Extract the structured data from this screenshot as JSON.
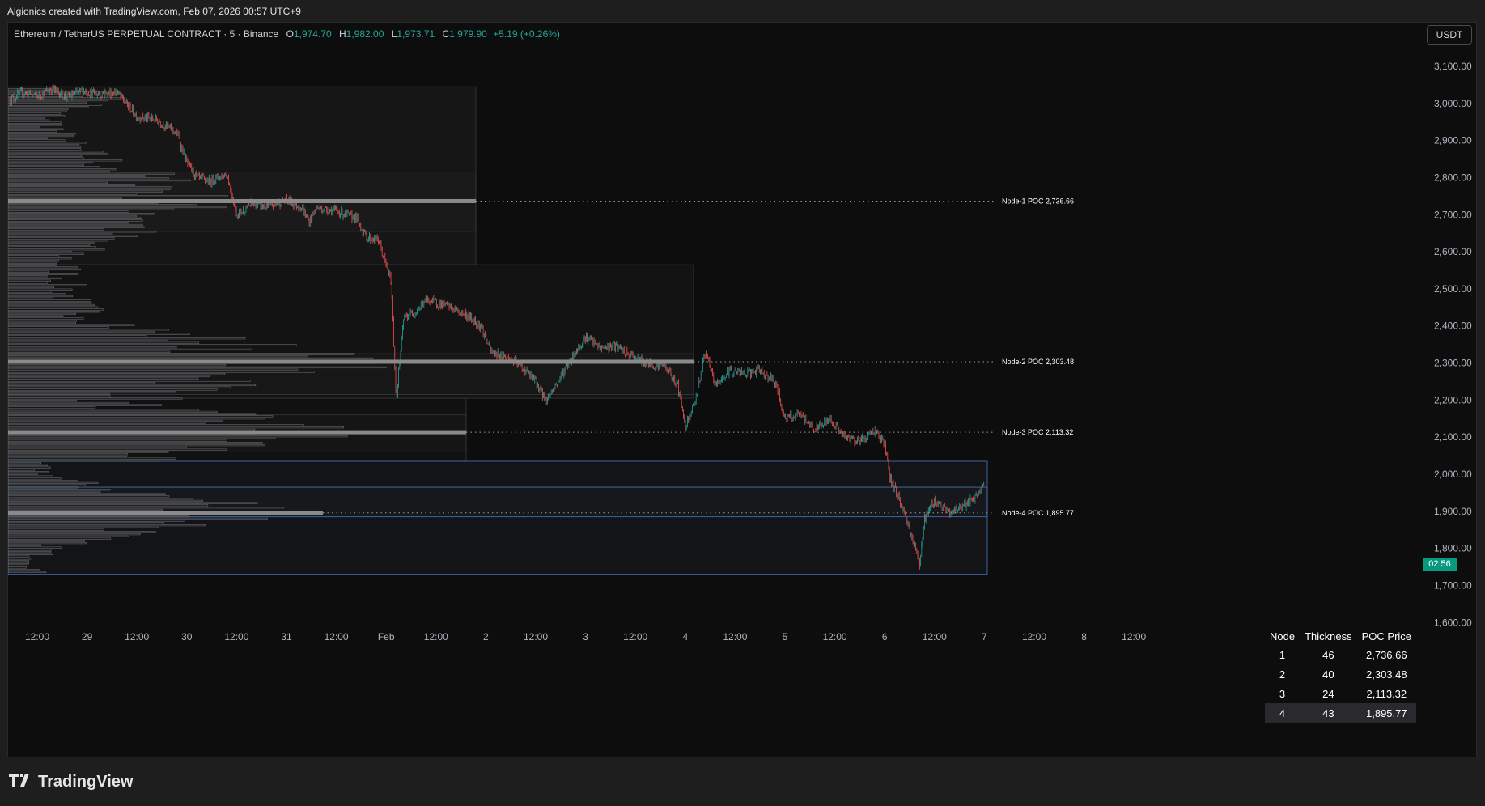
{
  "header": {
    "attribution": "Algionics created with TradingView.com, Feb 07, 2026 00:57 UTC+9"
  },
  "legend": {
    "symbol": "Ethereum / TetherUS PERPETUAL CONTRACT · 5 · Binance",
    "open_label": "O",
    "open": "1,974.70",
    "high_label": "H",
    "high": "1,982.00",
    "low_label": "L",
    "low": "1,973.71",
    "close_label": "C",
    "close": "1,979.90",
    "change": "+5.19 (+0.26%)"
  },
  "currency_button": "USDT",
  "countdown": "02:56",
  "table": {
    "headers": [
      "Node",
      "Thickness",
      "POC Price"
    ],
    "rows": [
      {
        "node": "1",
        "thickness": "46",
        "poc": "2,736.66"
      },
      {
        "node": "2",
        "thickness": "40",
        "poc": "2,303.48"
      },
      {
        "node": "3",
        "thickness": "24",
        "poc": "2,113.32"
      },
      {
        "node": "4",
        "thickness": "43",
        "poc": "1,895.77"
      }
    ]
  },
  "footer": {
    "brand": "TradingView"
  },
  "chart_data": {
    "type": "candlestick",
    "symbol": "ETHUSDT.P",
    "timeframe": "5",
    "x_ticks": [
      "12:00",
      "29",
      "12:00",
      "30",
      "12:00",
      "31",
      "12:00",
      "Feb",
      "12:00",
      "2",
      "12:00",
      "3",
      "12:00",
      "4",
      "12:00",
      "5",
      "12:00",
      "6",
      "12:00",
      "7",
      "12:00",
      "8",
      "12:00"
    ],
    "x_tick_units": [
      0,
      1,
      2,
      3,
      4,
      5,
      6,
      7,
      8,
      9,
      10,
      11,
      12,
      13,
      14,
      15,
      16,
      17,
      18,
      19,
      20,
      21,
      22
    ],
    "y_ticks": [
      "3,100.00",
      "3,000.00",
      "2,900.00",
      "2,800.00",
      "2,700.00",
      "2,600.00",
      "2,500.00",
      "2,400.00",
      "2,300.00",
      "2,200.00",
      "2,100.00",
      "2,000.00",
      "1,900.00",
      "1,800.00",
      "1,700.00",
      "1,600.00"
    ],
    "y_tick_values": [
      3100,
      3000,
      2900,
      2800,
      2700,
      2600,
      2500,
      2400,
      2300,
      2200,
      2100,
      2000,
      1900,
      1800,
      1700,
      1600
    ],
    "price_path": [
      [
        -0.55,
        3010
      ],
      [
        -0.3,
        3030
      ],
      [
        0.0,
        3020
      ],
      [
        0.3,
        3040
      ],
      [
        0.6,
        3015
      ],
      [
        0.9,
        3035
      ],
      [
        1.2,
        3025
      ],
      [
        1.6,
        3030
      ],
      [
        2.0,
        2965
      ],
      [
        2.4,
        2955
      ],
      [
        2.8,
        2920
      ],
      [
        3.0,
        2840
      ],
      [
        3.2,
        2800
      ],
      [
        3.45,
        2790
      ],
      [
        3.8,
        2810
      ],
      [
        4.0,
        2700
      ],
      [
        4.3,
        2730
      ],
      [
        4.6,
        2720
      ],
      [
        5.0,
        2740
      ],
      [
        5.3,
        2720
      ],
      [
        5.45,
        2680
      ],
      [
        5.6,
        2720
      ],
      [
        6.0,
        2710
      ],
      [
        6.4,
        2690
      ],
      [
        6.6,
        2640
      ],
      [
        6.85,
        2630
      ],
      [
        7.0,
        2560
      ],
      [
        7.1,
        2520
      ],
      [
        7.2,
        2200
      ],
      [
        7.35,
        2420
      ],
      [
        7.6,
        2440
      ],
      [
        7.8,
        2470
      ],
      [
        8.2,
        2455
      ],
      [
        8.6,
        2430
      ],
      [
        8.9,
        2400
      ],
      [
        9.1,
        2330
      ],
      [
        9.5,
        2310
      ],
      [
        9.8,
        2280
      ],
      [
        10.0,
        2250
      ],
      [
        10.2,
        2200
      ],
      [
        10.4,
        2240
      ],
      [
        10.7,
        2310
      ],
      [
        11.0,
        2370
      ],
      [
        11.3,
        2340
      ],
      [
        11.6,
        2345
      ],
      [
        11.9,
        2320
      ],
      [
        12.2,
        2300
      ],
      [
        12.6,
        2290
      ],
      [
        12.85,
        2240
      ],
      [
        13.0,
        2130
      ],
      [
        13.2,
        2200
      ],
      [
        13.4,
        2330
      ],
      [
        13.6,
        2240
      ],
      [
        13.9,
        2280
      ],
      [
        14.2,
        2270
      ],
      [
        14.5,
        2280
      ],
      [
        14.8,
        2250
      ],
      [
        15.0,
        2150
      ],
      [
        15.3,
        2160
      ],
      [
        15.6,
        2120
      ],
      [
        15.9,
        2150
      ],
      [
        16.2,
        2100
      ],
      [
        16.5,
        2090
      ],
      [
        16.8,
        2120
      ],
      [
        17.0,
        2080
      ],
      [
        17.1,
        1990
      ],
      [
        17.3,
        1930
      ],
      [
        17.5,
        1850
      ],
      [
        17.7,
        1760
      ],
      [
        17.8,
        1880
      ],
      [
        18.0,
        1930
      ],
      [
        18.3,
        1895
      ],
      [
        18.6,
        1920
      ],
      [
        18.8,
        1930
      ],
      [
        19.0,
        1979.9
      ]
    ],
    "volume_profile_nodes": [
      {
        "node": 1,
        "thickness": 46,
        "poc": 2736.66,
        "range_low": 2655,
        "range_high": 2815
      },
      {
        "node": 2,
        "thickness": 40,
        "poc": 2303.48,
        "range_low": 2215,
        "range_high": 2325
      },
      {
        "node": 3,
        "thickness": 24,
        "poc": 2113.32,
        "range_low": 2060,
        "range_high": 2160
      },
      {
        "node": 4,
        "thickness": 43,
        "poc": 1895.77,
        "range_low": 1885,
        "range_high": 1965
      }
    ],
    "node_labels": [
      "Node-1 POC 2,736.66",
      "Node-2 POC 2,303.48",
      "Node-3 POC 2,113.32",
      "Node-4 POC 1,895.77"
    ],
    "last_price": 1979.9,
    "colors": {
      "up": "#26a69a",
      "down": "#ef5350",
      "background": "#0d0d0e",
      "profile": "#7a7a7a",
      "poc": "#8a8a8a",
      "node4_box": "#4a78c2",
      "price_tag": "#089981"
    }
  }
}
